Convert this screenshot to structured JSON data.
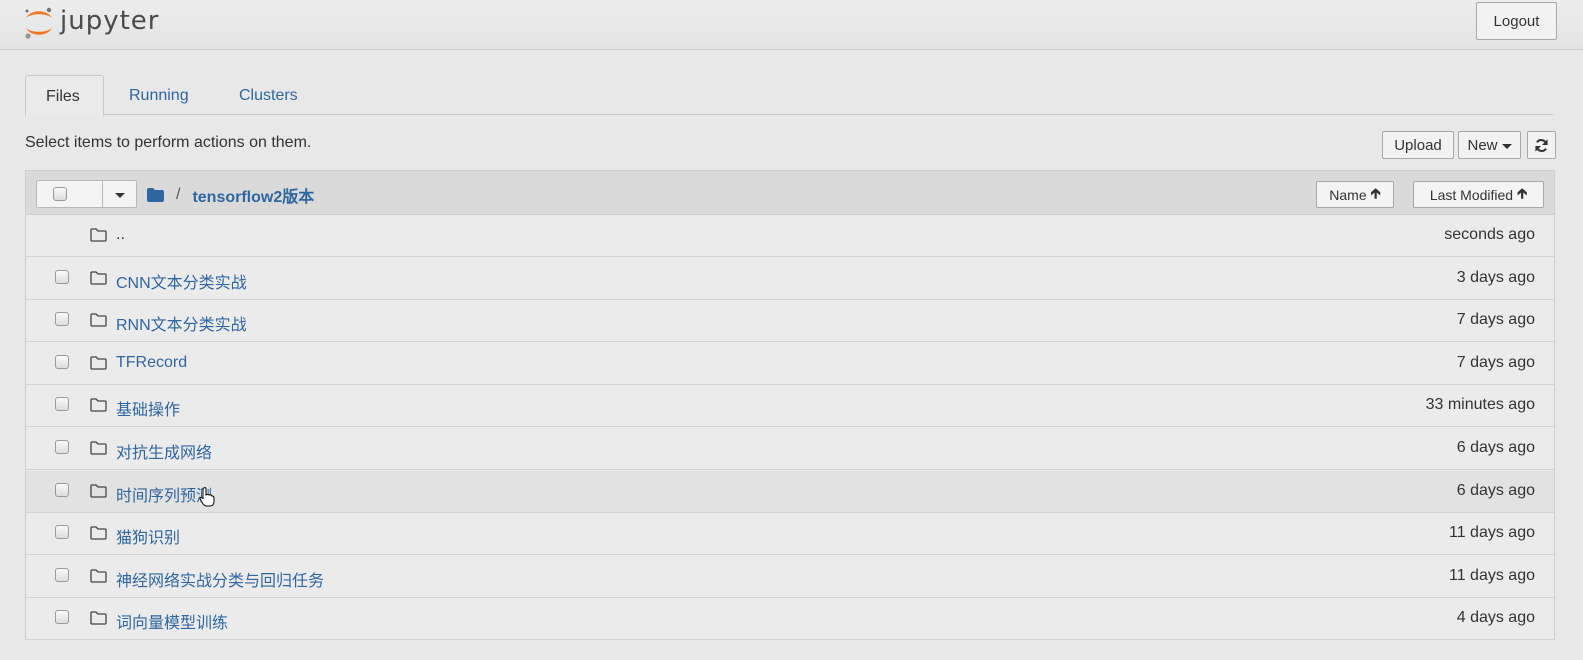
{
  "header": {
    "logo_text": "jupyter",
    "logout_label": "Logout"
  },
  "tabs": [
    {
      "label": "Files",
      "active": true
    },
    {
      "label": "Running",
      "active": false
    },
    {
      "label": "Clusters",
      "active": false
    }
  ],
  "instructions": "Select items to perform actions on them.",
  "toolbar": {
    "upload_label": "Upload",
    "new_label": "New",
    "refresh_icon": "refresh-icon"
  },
  "list_header": {
    "breadcrumb_separator": "/",
    "current_folder": "tensorflow2版本",
    "sort_name_label": "Name",
    "sort_modified_label": "Last Modified"
  },
  "rows": [
    {
      "name": "..",
      "modified": "seconds ago",
      "type": "parent"
    },
    {
      "name": "CNN文本分类实战",
      "modified": "3 days ago",
      "type": "folder"
    },
    {
      "name": "RNN文本分类实战",
      "modified": "7 days ago",
      "type": "folder"
    },
    {
      "name": "TFRecord",
      "modified": "7 days ago",
      "type": "folder"
    },
    {
      "name": "基础操作",
      "modified": "33 minutes ago",
      "type": "folder"
    },
    {
      "name": "对抗生成网络",
      "modified": "6 days ago",
      "type": "folder"
    },
    {
      "name": "时间序列预测",
      "modified": "6 days ago",
      "type": "folder",
      "hovered": true
    },
    {
      "name": "猫狗识别",
      "modified": "11 days ago",
      "type": "folder"
    },
    {
      "name": "神经网络实战分类与回归任务",
      "modified": "11 days ago",
      "type": "folder"
    },
    {
      "name": "词向量模型训练",
      "modified": "4 days ago",
      "type": "folder"
    }
  ],
  "colors": {
    "link": "#2e67a0",
    "logo_orange": "#f37726"
  }
}
